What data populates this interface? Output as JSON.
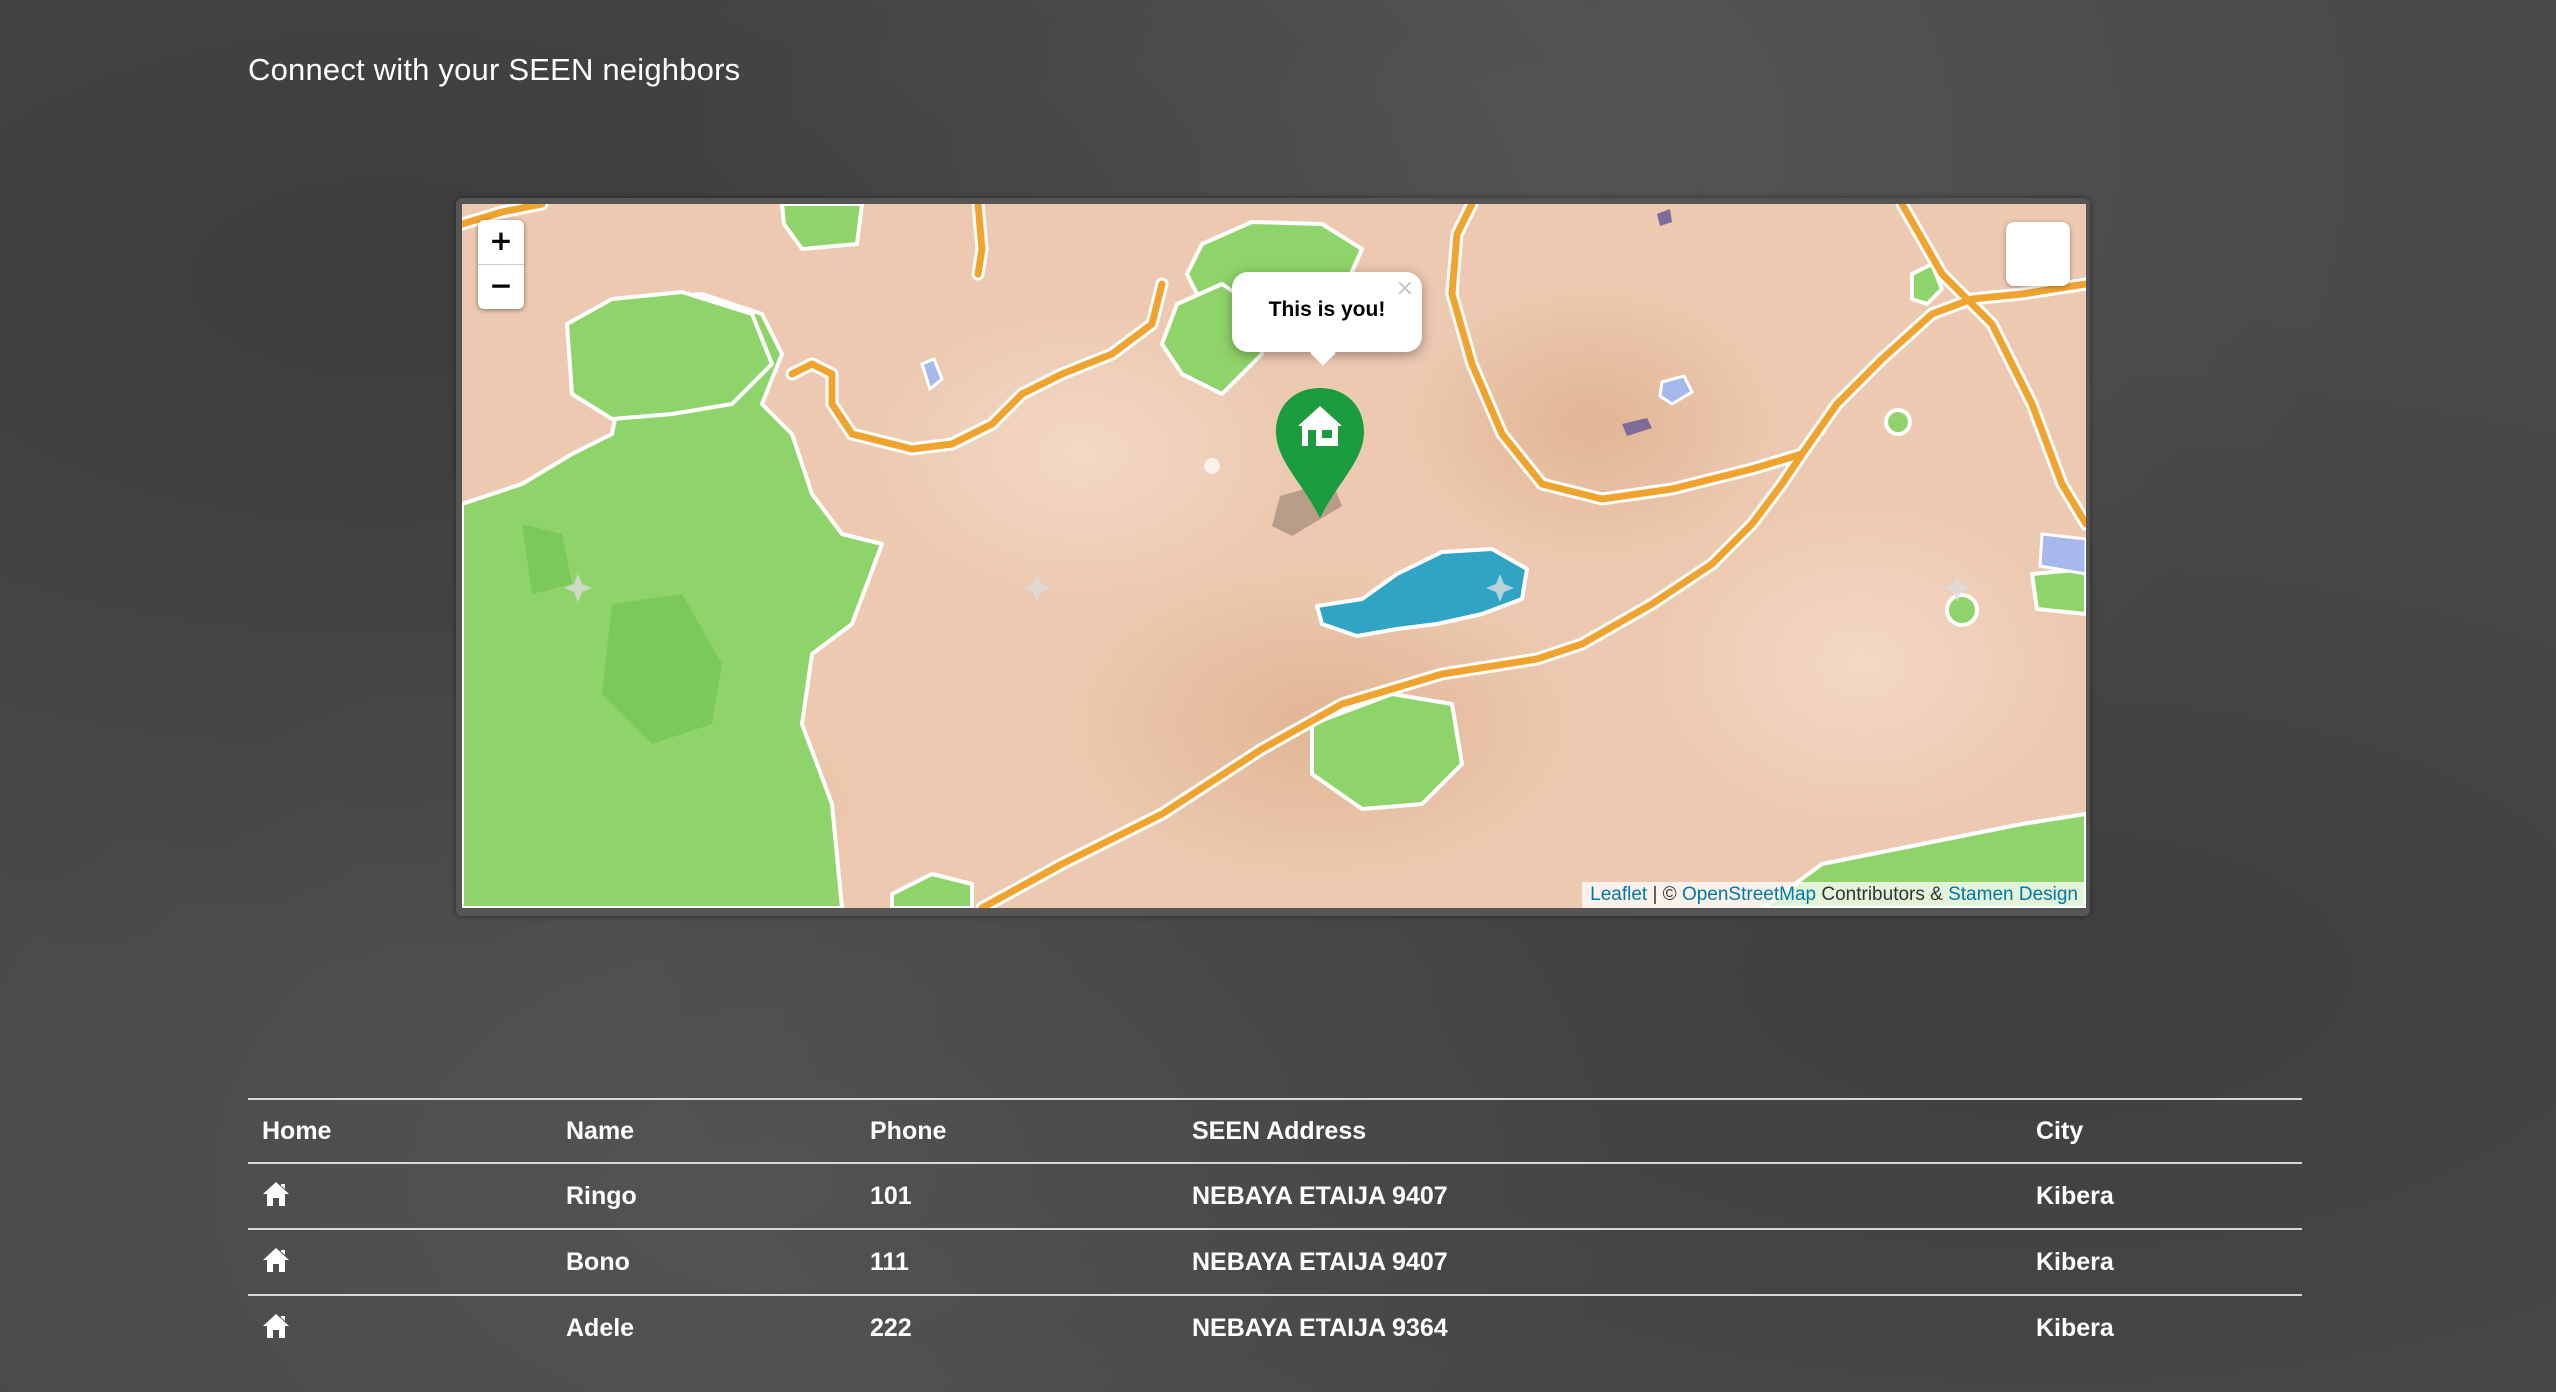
{
  "page": {
    "title": "Connect with your SEEN neighbors"
  },
  "map": {
    "zoom_in_label": "+",
    "zoom_out_label": "−",
    "popup_text": "This is you!",
    "popup_close_label": "×",
    "marker_icon": "home-marker-icon",
    "marker_color": "#1a9b3e",
    "attribution": {
      "leaflet_link": "Leaflet",
      "separator": " | © ",
      "osm_link": "OpenStreetMap",
      "contributors_text": " Contributors & ",
      "stamen_link": "Stamen Design"
    }
  },
  "table": {
    "headers": {
      "home": "Home",
      "name": "Name",
      "phone": "Phone",
      "address": "SEEN Address",
      "city": "City"
    },
    "rows": [
      {
        "name": "Ringo",
        "phone": "101",
        "address": "NEBAYA ETAIJA 9407",
        "city": "Kibera"
      },
      {
        "name": "Bono",
        "phone": "111",
        "address": "NEBAYA ETAIJA 9407",
        "city": "Kibera"
      },
      {
        "name": "Adele",
        "phone": "222",
        "address": "NEBAYA ETAIJA 9364",
        "city": "Kibera"
      }
    ],
    "row_icon": "home-icon"
  },
  "colors": {
    "background": "#4a4a4a",
    "link": "#0078a8",
    "map_land": "#ecc9b0",
    "map_park": "#8fd46a",
    "map_road": "#f0a430",
    "map_water": "#2fa4c4"
  }
}
